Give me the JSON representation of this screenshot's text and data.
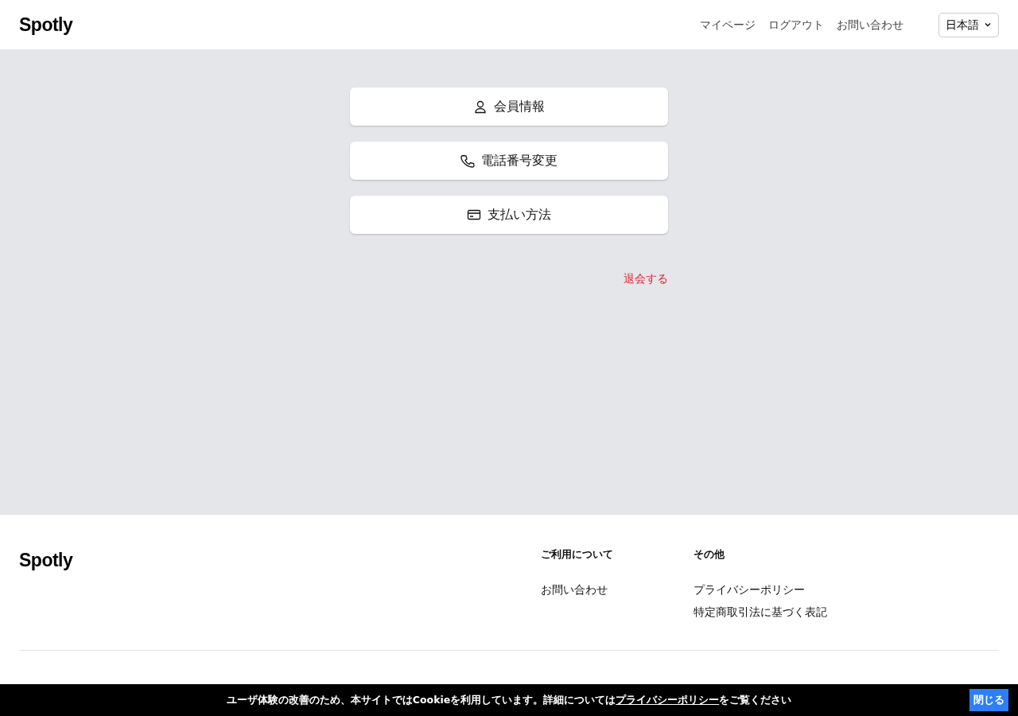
{
  "header": {
    "logo": "Spotly",
    "nav": [
      "マイページ",
      "ログアウト",
      "お問い合わせ"
    ],
    "language": "日本語"
  },
  "menu": [
    {
      "kind": "person",
      "label": "会員情報"
    },
    {
      "kind": "phone",
      "label": "電話番号変更"
    },
    {
      "kind": "card",
      "label": "支払い方法"
    }
  ],
  "withdraw": "退会する",
  "footer": {
    "logo": "Spotly",
    "columns": [
      {
        "title": "ご利用について",
        "links": [
          "お問い合わせ"
        ]
      },
      {
        "title": "その他",
        "links": [
          "プライバシーポリシー",
          "特定商取引法に基づく表記"
        ]
      }
    ]
  },
  "cookie_bar": {
    "before": "ユーザ体験の改善のため、本サイトではCookieを利用しています。詳細については",
    "link": "プライバシーポリシー",
    "after": "をご覧ください",
    "close": "閉じる"
  }
}
